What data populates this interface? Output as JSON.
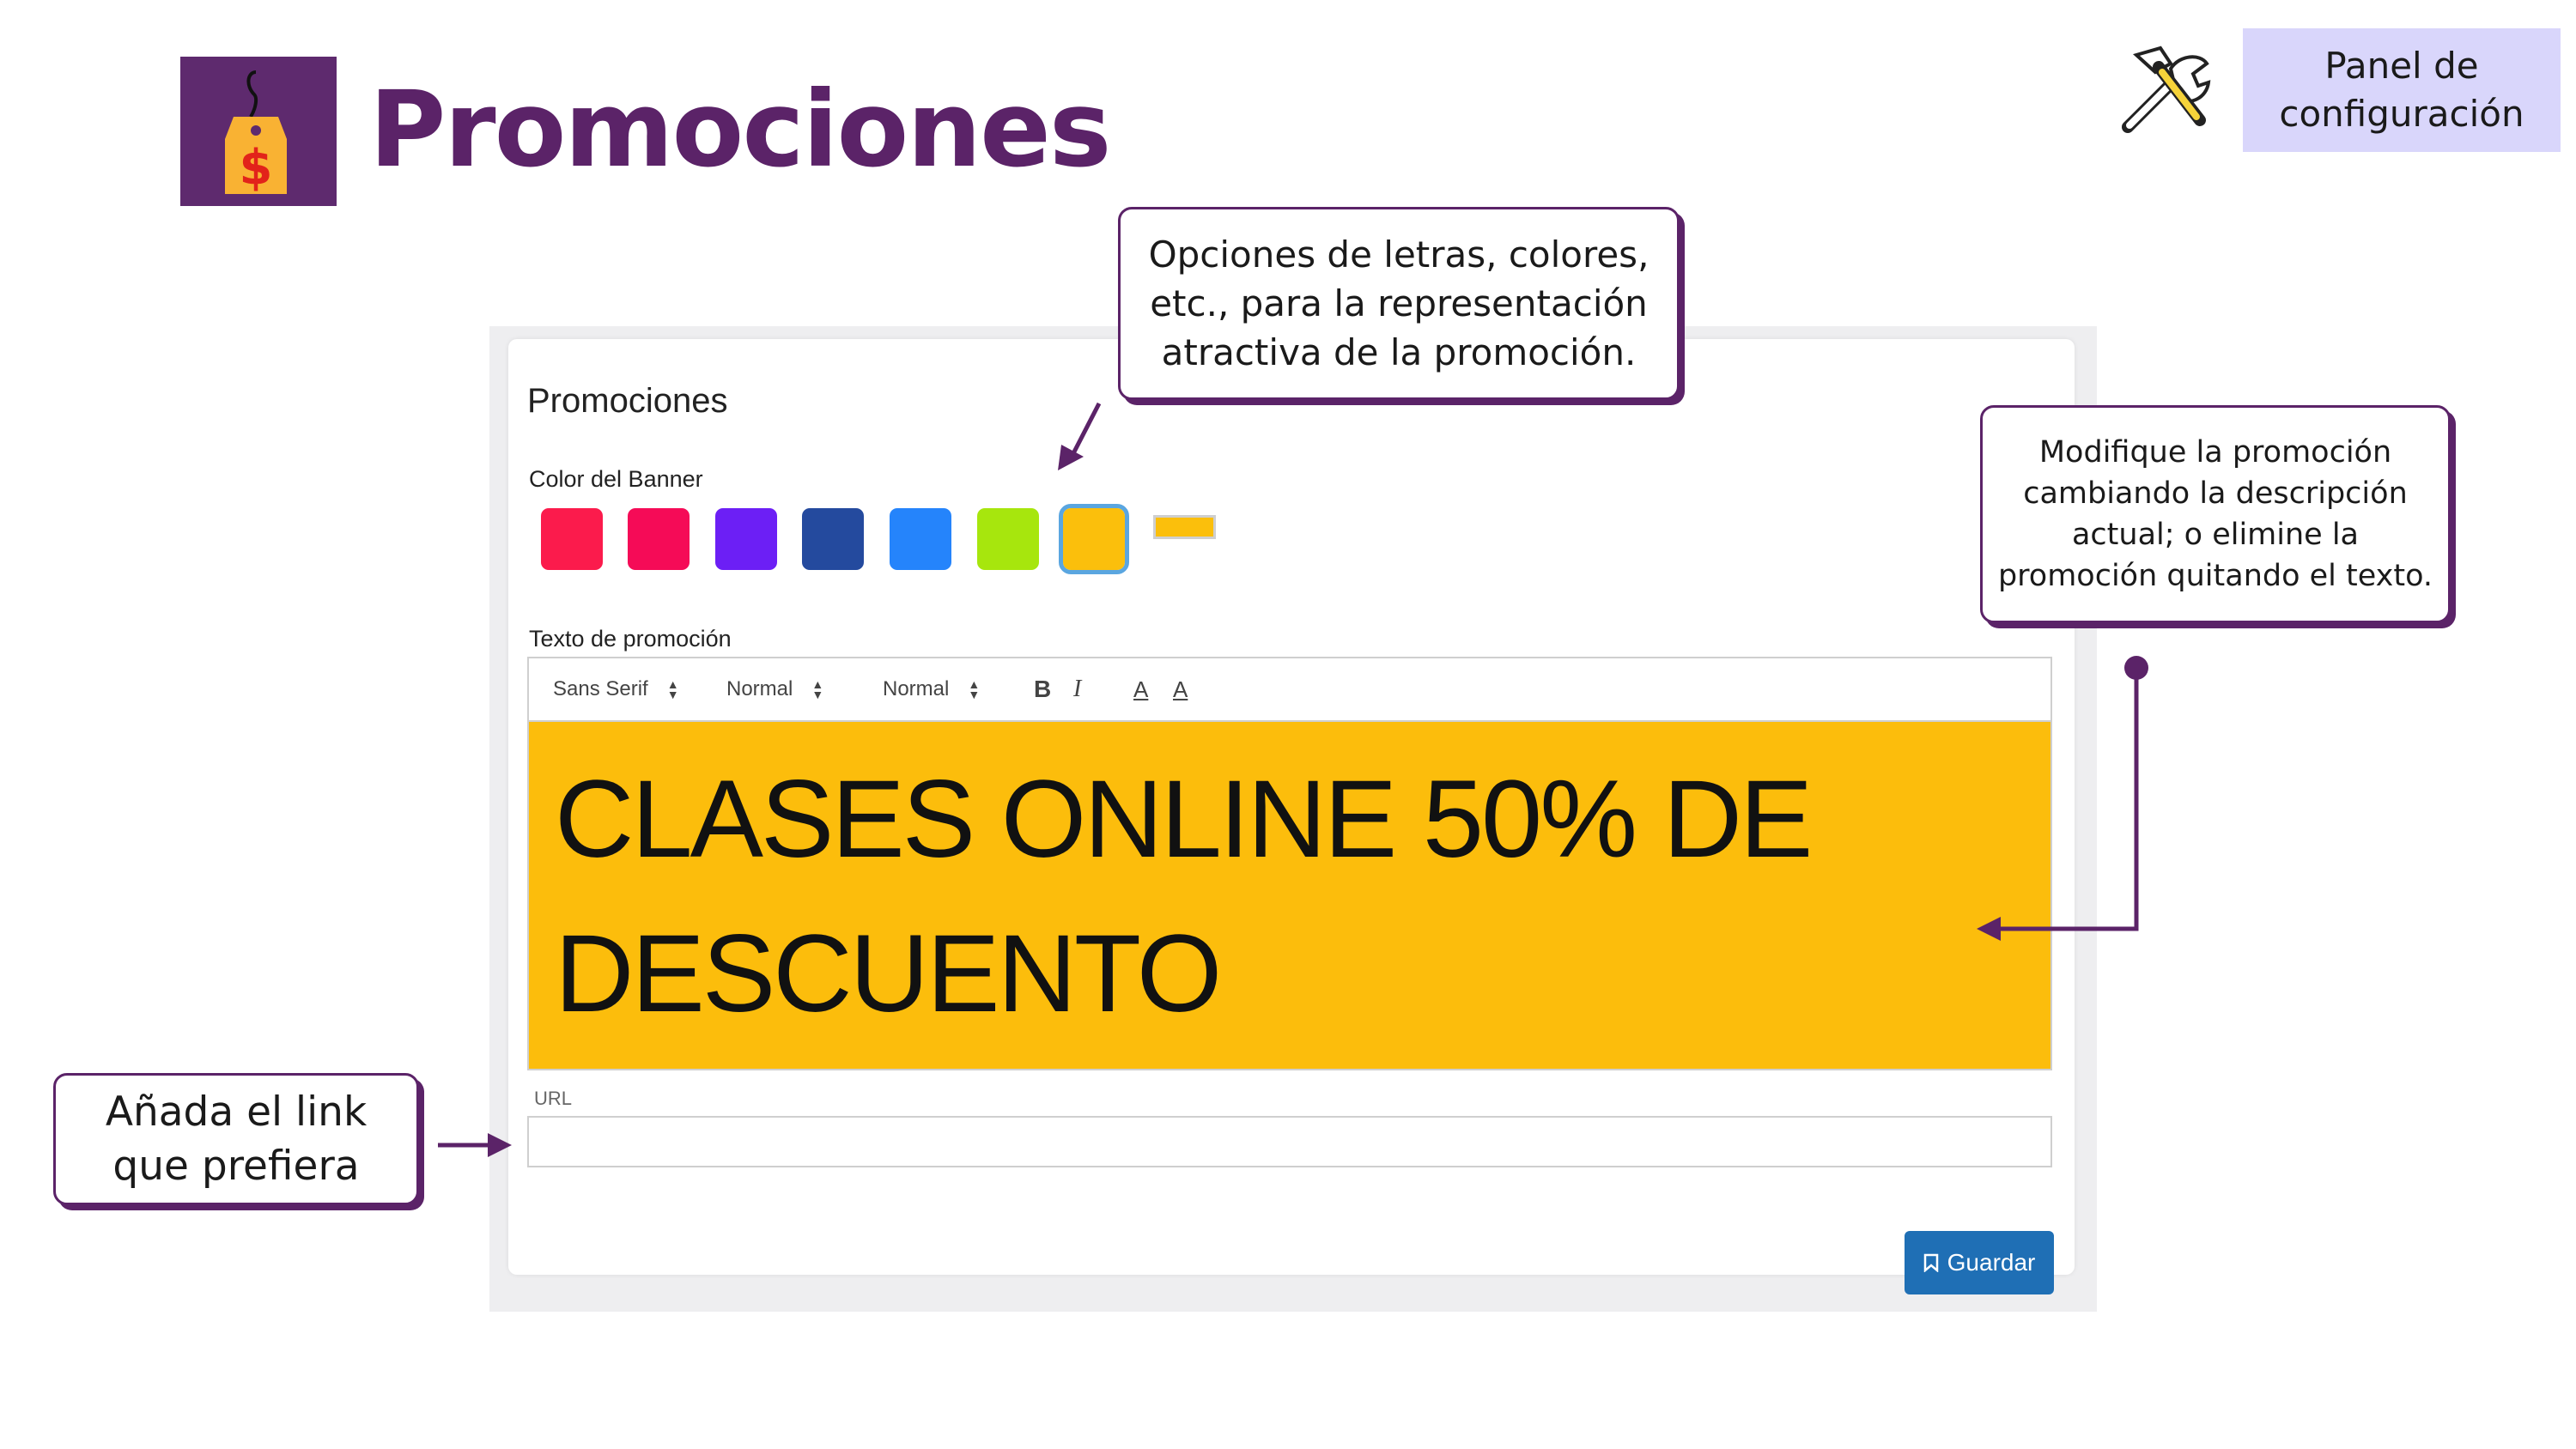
{
  "header": {
    "title": "Promociones",
    "panel_button": "Panel de configuración"
  },
  "card": {
    "title": "Promociones",
    "banner_color_label": "Color del Banner",
    "swatches": [
      {
        "color": "#fb1b4c"
      },
      {
        "color": "#f50b57"
      },
      {
        "color": "#6c1ff5"
      },
      {
        "color": "#244a9e"
      },
      {
        "color": "#2584fb"
      },
      {
        "color": "#a7e60d"
      },
      {
        "color": "#fbbf0c",
        "selected": true
      }
    ],
    "custom_color": "#fbbf0c",
    "promo_text_label": "Texto de promoción",
    "toolbar": {
      "font": "Sans Serif",
      "size": "Normal",
      "heading": "Normal",
      "bold": "B",
      "italic": "I",
      "font_color": "A",
      "background_color": "A"
    },
    "promo_text": "CLASES ONLINE 50% DE DESCUENTO",
    "url_label": "URL",
    "url_value": "",
    "save_button": "Guardar"
  },
  "callouts": {
    "formatting": "Opciones de letras, colores, etc., para la representación atractiva de la promoción.",
    "edit": "Modifique la promoción cambiando la descripción actual; o elimine la promoción quitando el texto.",
    "link": "Añada el link que prefiera"
  },
  "colors": {
    "brand_purple": "#5b2368",
    "panel_button_bg": "#d9d6fb",
    "banner_yellow": "#fcbd0c",
    "save_blue": "#1f6fb5"
  }
}
